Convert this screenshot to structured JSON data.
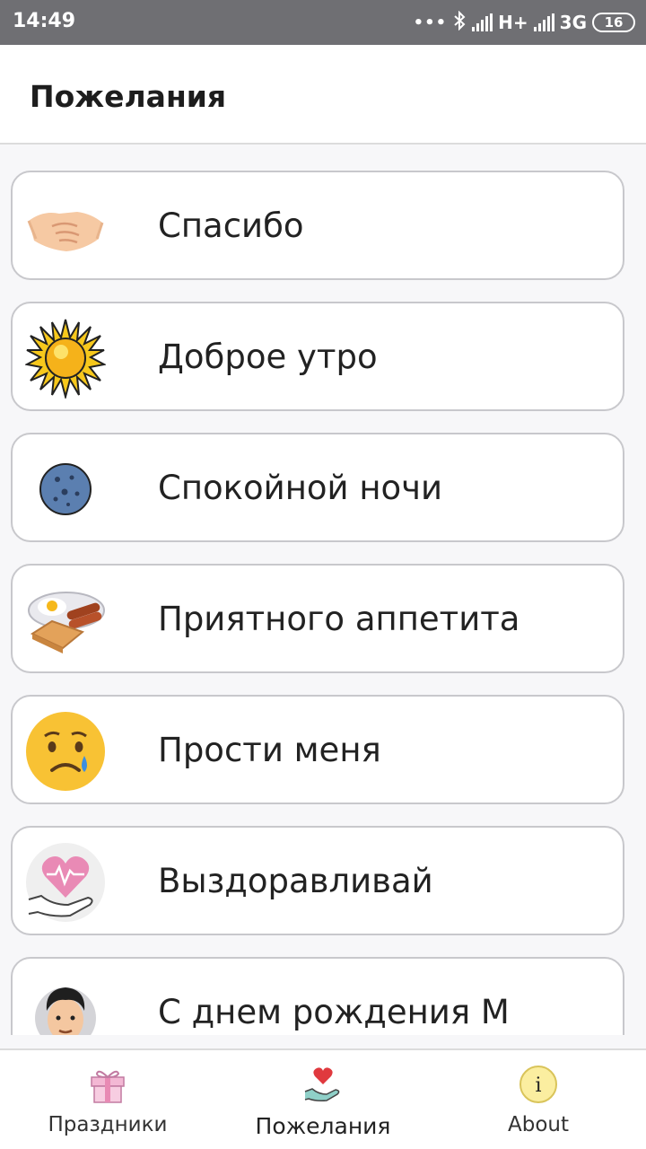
{
  "status_bar": {
    "time": "14:49",
    "network_1": "H+",
    "network_2": "3G",
    "battery": "16"
  },
  "app_bar": {
    "title": "Пожелания"
  },
  "list": {
    "items": [
      {
        "label": "Спасибо",
        "icon": "handshake-icon"
      },
      {
        "label": "Доброе утро",
        "icon": "sun-icon"
      },
      {
        "label": "Спокойной ночи",
        "icon": "moon-icon"
      },
      {
        "label": "Приятного аппетита",
        "icon": "breakfast-icon"
      },
      {
        "label": "Прости меня",
        "icon": "sad-face-icon"
      },
      {
        "label": "Выздоравливай",
        "icon": "heart-hand-icon"
      },
      {
        "label": "С днем рождения М",
        "icon": "man-avatar-icon"
      }
    ]
  },
  "bottom_nav": {
    "items": [
      {
        "label": "Праздники",
        "icon": "gift-icon"
      },
      {
        "label": "Пожелания",
        "icon": "heart-hand-icon",
        "active": true
      },
      {
        "label": "About",
        "icon": "info-icon"
      }
    ]
  },
  "colors": {
    "status_bar": "#6f6f73",
    "card_border": "#c8c8cc",
    "background": "#f7f7f9"
  }
}
